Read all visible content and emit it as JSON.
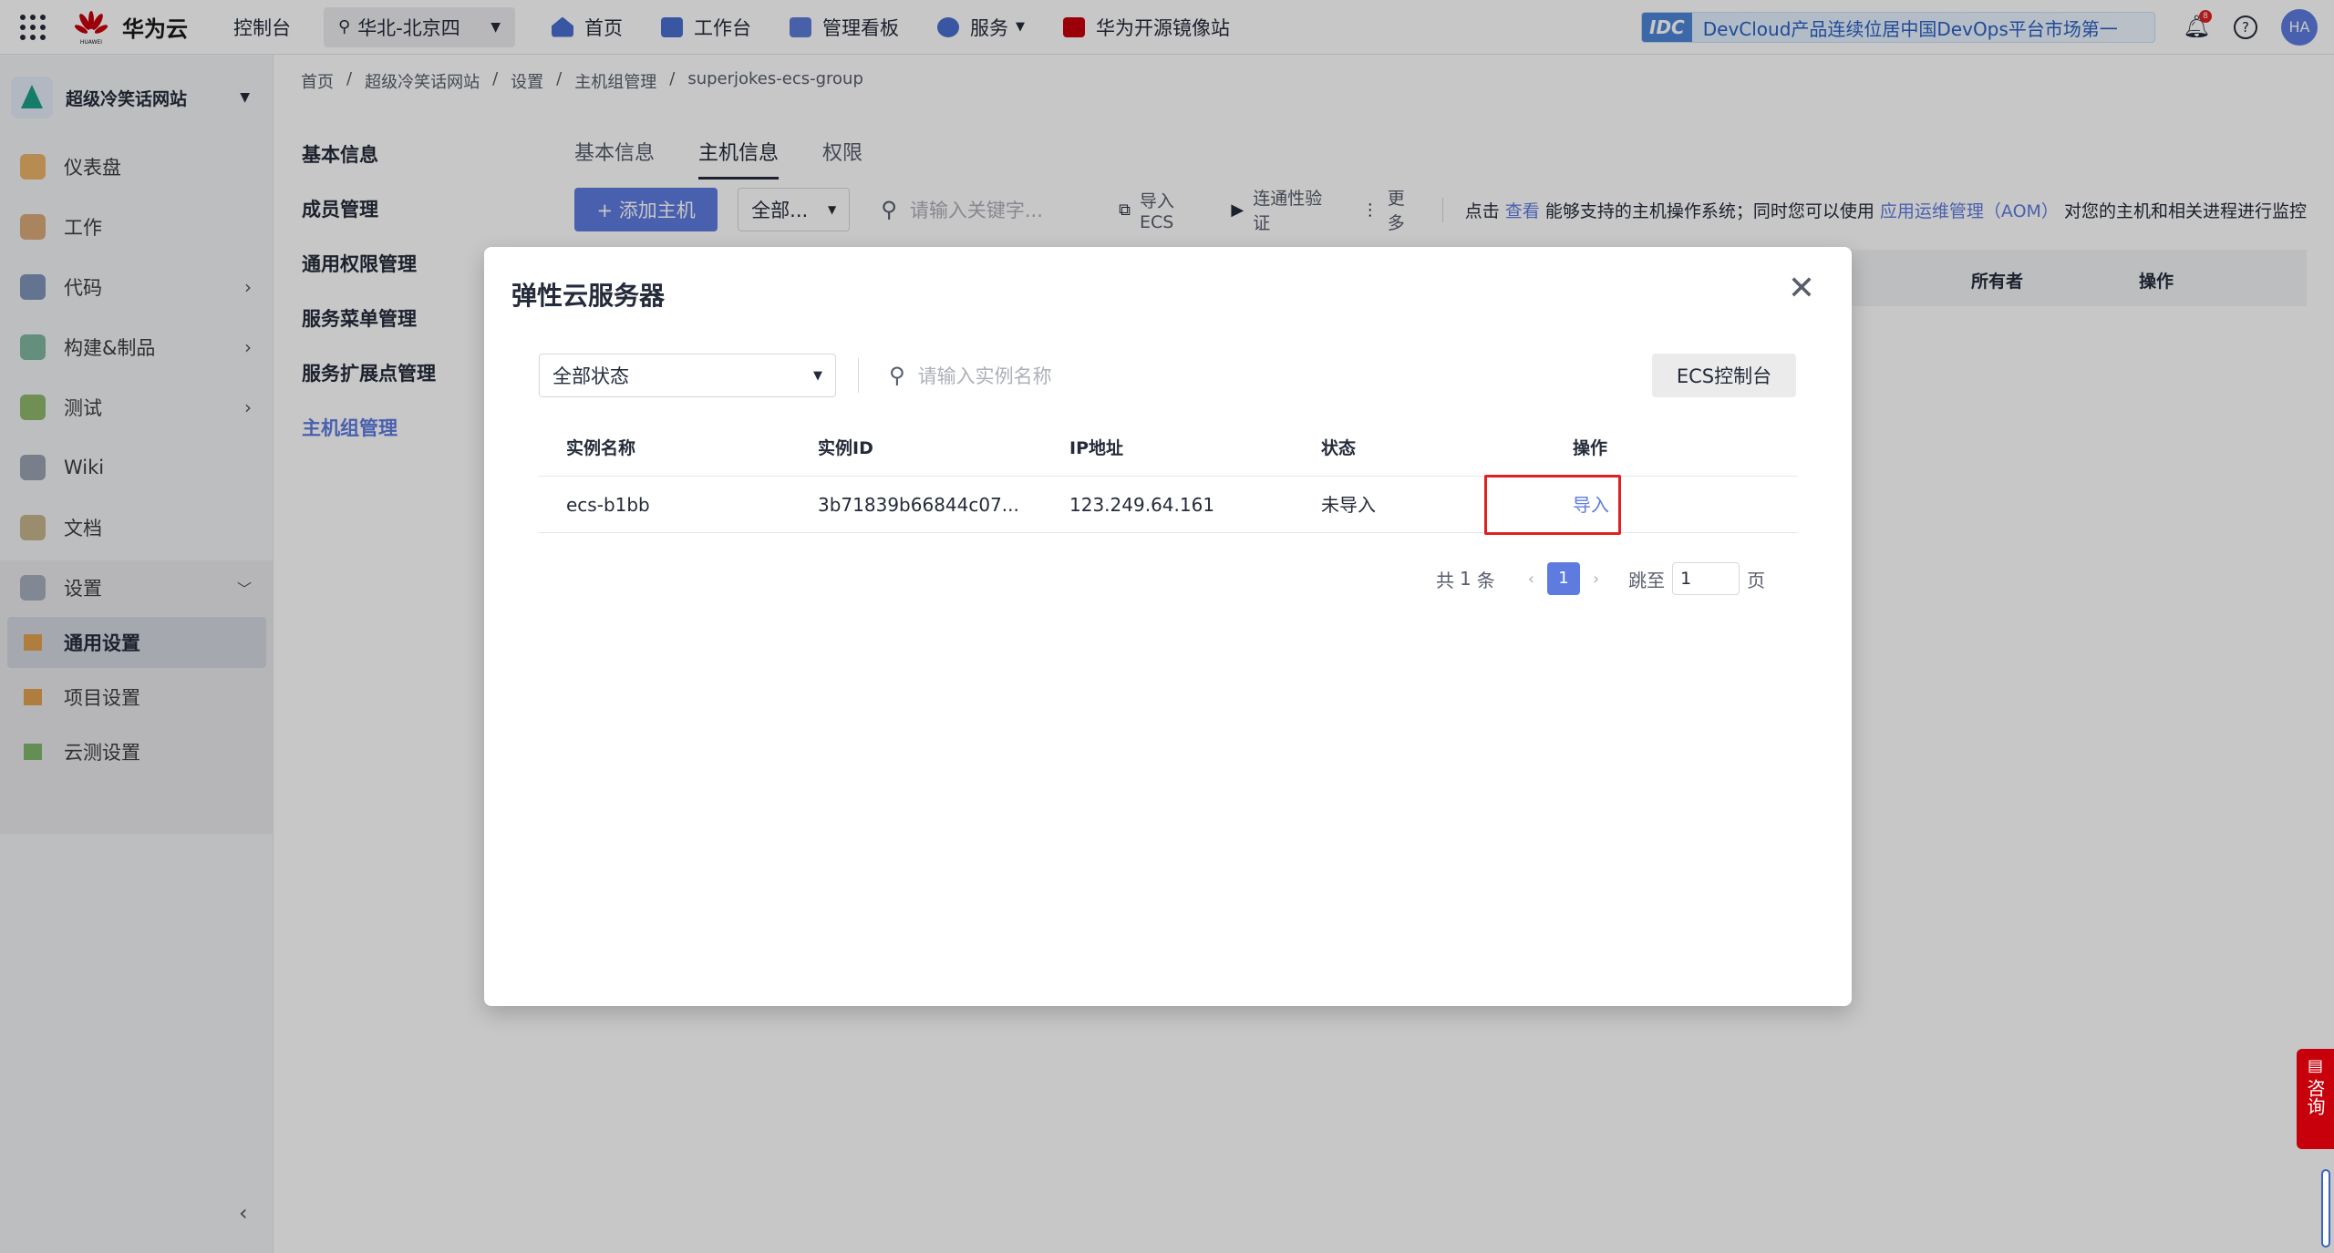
{
  "topnav": {
    "brand": "华为云",
    "brand_sub": "HUAWEI",
    "console": "控制台",
    "region": "华北-北京四",
    "menu": [
      {
        "label": "首页",
        "icon": "home-icon"
      },
      {
        "label": "工作台",
        "icon": "workbench-icon"
      },
      {
        "label": "管理看板",
        "icon": "dashboard-board-icon"
      },
      {
        "label": "服务",
        "icon": "services-icon"
      },
      {
        "label": "华为开源镜像站",
        "icon": "mirror-icon"
      }
    ],
    "banner_badge": "IDC",
    "banner_text": "DevCloud产品连续位居中国DevOps平台市场第一",
    "notification_count": "8",
    "avatar": "HA"
  },
  "sidebar": {
    "project": "超级冷笑话网站",
    "items": [
      {
        "label": "仪表盘",
        "has_arrow": false
      },
      {
        "label": "工作",
        "has_arrow": false
      },
      {
        "label": "代码",
        "has_arrow": true
      },
      {
        "label": "构建&制品",
        "has_arrow": true
      },
      {
        "label": "测试",
        "has_arrow": true
      },
      {
        "label": "Wiki",
        "has_arrow": false
      },
      {
        "label": "文档",
        "has_arrow": false
      },
      {
        "label": "设置",
        "has_arrow": true
      }
    ],
    "settings_sub": [
      {
        "label": "通用设置",
        "active": true
      },
      {
        "label": "项目设置",
        "active": false
      },
      {
        "label": "云测设置",
        "active": false
      }
    ]
  },
  "breadcrumb": [
    "首页",
    "/",
    "超级冷笑话网站",
    "/",
    "设置",
    "/",
    "主机组管理",
    "/",
    "superjokes-ecs-group"
  ],
  "sub_nav": [
    "基本信息",
    "成员管理",
    "通用权限管理",
    "服务菜单管理",
    "服务扩展点管理",
    "主机组管理"
  ],
  "main": {
    "tabs": [
      "基本信息",
      "主机信息",
      "权限"
    ],
    "active_tab": "主机信息",
    "add_host": "+ 添加主机",
    "filter": "全部...",
    "search_placeholder": "请输入关键字...",
    "import_ecs": "导入ECS",
    "connectivity": "连通性验证",
    "more": "更多",
    "note_prefix": "点击",
    "note_link1": "查看",
    "note_mid": "能够支持的主机操作系统；同时您可以使用",
    "note_link2": "应用运维管理（AOM）",
    "note_suffix": "对您的主机和相关进程进行监控",
    "table_headers": [
      "所有者",
      "操作"
    ]
  },
  "modal": {
    "title": "弹性云服务器",
    "status_filter": "全部状态",
    "search_placeholder": "请输入实例名称",
    "ecs_console": "ECS控制台",
    "columns": [
      "实例名称",
      "实例ID",
      "IP地址",
      "状态",
      "操作"
    ],
    "rows": [
      {
        "name": "ecs-b1bb",
        "id": "3b71839b66844c07...",
        "ip": "123.249.64.161",
        "status": "未导入",
        "action": "导入"
      }
    ],
    "pager": {
      "total_prefix": "共",
      "total": "1",
      "total_suffix": "条",
      "current": "1",
      "jump": "跳至",
      "page_value": "1",
      "page_suffix": "页"
    }
  },
  "consult": "咨询",
  "colors": {
    "accent": "#5e7ce0",
    "highlight": "#e02020",
    "consult": "#c7000b"
  }
}
